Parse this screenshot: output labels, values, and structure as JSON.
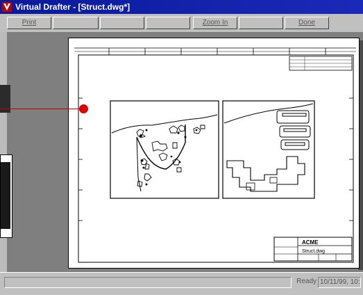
{
  "window": {
    "title": "Virtual Drafter - [Struct.dwg*]"
  },
  "toolbar": {
    "buttons": [
      {
        "label": "Print"
      },
      {
        "label": ""
      },
      {
        "label": ""
      },
      {
        "label": ""
      },
      {
        "label": "Zoom In"
      },
      {
        "label": ""
      },
      {
        "label": "Done"
      }
    ]
  },
  "drawing": {
    "title_block": {
      "line1": "ACME",
      "line2": "Struct.dwg"
    }
  },
  "status": {
    "ready": "Ready",
    "datetime": "10/11/99, 10:"
  },
  "colors": {
    "title_bar": "#0a1a9a",
    "accent_red": "#dd0000",
    "chrome": "#c0c0c0"
  }
}
